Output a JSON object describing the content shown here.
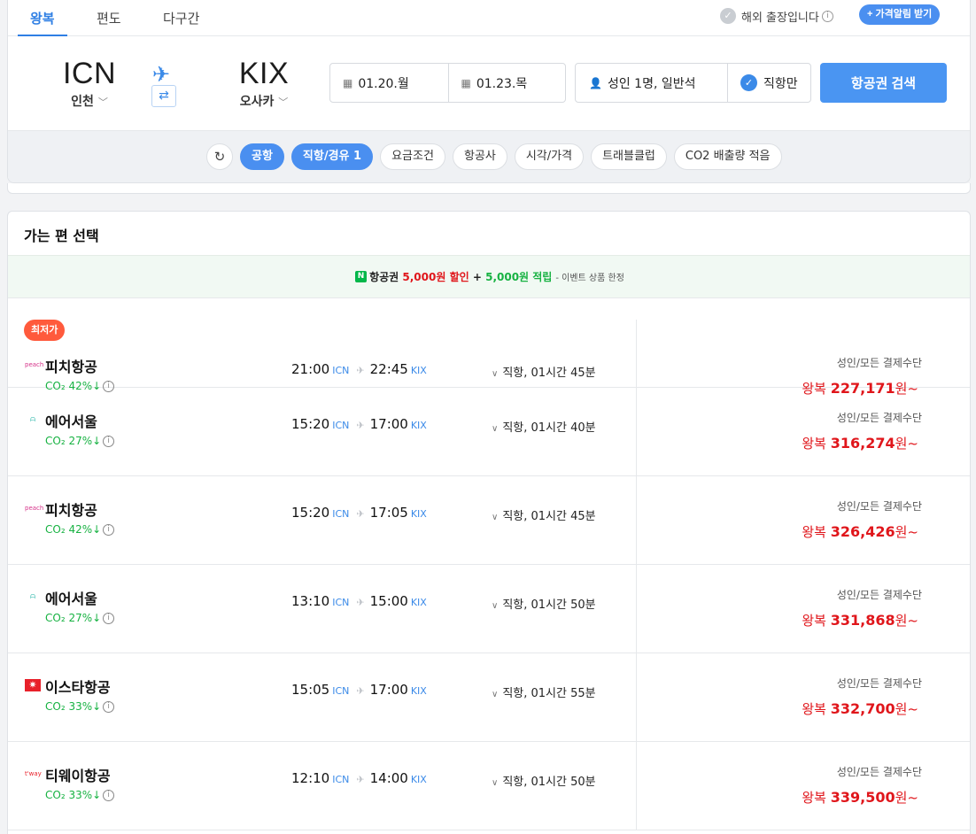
{
  "tabs": {
    "round_trip": "왕복",
    "one_way": "편도",
    "multi_city": "다구간"
  },
  "header": {
    "business_trip_label": "해외 출장입니다",
    "price_alert_button": "가격알림 받기"
  },
  "search": {
    "origin_code": "ICN",
    "origin_city": "인천",
    "destination_code": "KIX",
    "destination_city": "오사카",
    "depart_date": "01.20.월",
    "return_date": "01.23.목",
    "passengers": "성인 1명, 일반석",
    "direct_only_label": "직항만",
    "search_button": "항공권 검색"
  },
  "filters": [
    "공항",
    "직항/경유 1",
    "요금조건",
    "항공사",
    "시각/가격",
    "트래블클럽",
    "CO2 배출량 적음"
  ],
  "results": {
    "title": "가는 편 선택",
    "promo": {
      "n_icon": "N",
      "text1": "항공권",
      "discount": "5,000원 할인",
      "plus": "+",
      "points": "5,000원 적립",
      "note": "- 이벤트 상품 한정"
    },
    "lowest_badge": "최저가",
    "direct_prefix": "직항, ",
    "flights": [
      {
        "airline": "피치항공",
        "logo": "peach-logo",
        "co2": "CO₂ 42%↓",
        "dep_time": "21:00",
        "dep_ap": "ICN",
        "arr_time": "22:45",
        "arr_ap": "KIX",
        "duration": "직항, 01시간 45분",
        "pay": "성인/모든 결제수단",
        "trip": "왕복",
        "price": "227,171",
        "unit": "원~"
      },
      {
        "airline": "에어서울",
        "logo": "airseoul-logo",
        "co2": "CO₂ 27%↓",
        "dep_time": "15:20",
        "dep_ap": "ICN",
        "arr_time": "17:00",
        "arr_ap": "KIX",
        "duration": "직항, 01시간 40분",
        "pay": "성인/모든 결제수단",
        "trip": "왕복",
        "price": "316,274",
        "unit": "원~"
      },
      {
        "airline": "피치항공",
        "logo": "peach-logo",
        "co2": "CO₂ 42%↓",
        "dep_time": "15:20",
        "dep_ap": "ICN",
        "arr_time": "17:05",
        "arr_ap": "KIX",
        "duration": "직항, 01시간 45분",
        "pay": "성인/모든 결제수단",
        "trip": "왕복",
        "price": "326,426",
        "unit": "원~"
      },
      {
        "airline": "에어서울",
        "logo": "airseoul-logo",
        "co2": "CO₂ 27%↓",
        "dep_time": "13:10",
        "dep_ap": "ICN",
        "arr_time": "15:00",
        "arr_ap": "KIX",
        "duration": "직항, 01시간 50분",
        "pay": "성인/모든 결제수단",
        "trip": "왕복",
        "price": "331,868",
        "unit": "원~"
      },
      {
        "airline": "이스타항공",
        "logo": "eastar-logo",
        "co2": "CO₂ 33%↓",
        "dep_time": "15:05",
        "dep_ap": "ICN",
        "arr_time": "17:00",
        "arr_ap": "KIX",
        "duration": "직항, 01시간 55분",
        "pay": "성인/모든 결제수단",
        "trip": "왕복",
        "price": "332,700",
        "unit": "원~"
      },
      {
        "airline": "티웨이항공",
        "logo": "tway-logo",
        "co2": "CO₂ 33%↓",
        "dep_time": "12:10",
        "dep_ap": "ICN",
        "arr_time": "14:00",
        "arr_ap": "KIX",
        "duration": "직항, 01시간 50분",
        "pay": "성인/모든 결제수단",
        "trip": "왕복",
        "price": "339,500",
        "unit": "원~"
      }
    ]
  },
  "colors": {
    "accent": "#4a8ff0",
    "price_red": "#e0161b",
    "co2_green": "#17b242",
    "badge_orange": "#ff5a3c"
  }
}
